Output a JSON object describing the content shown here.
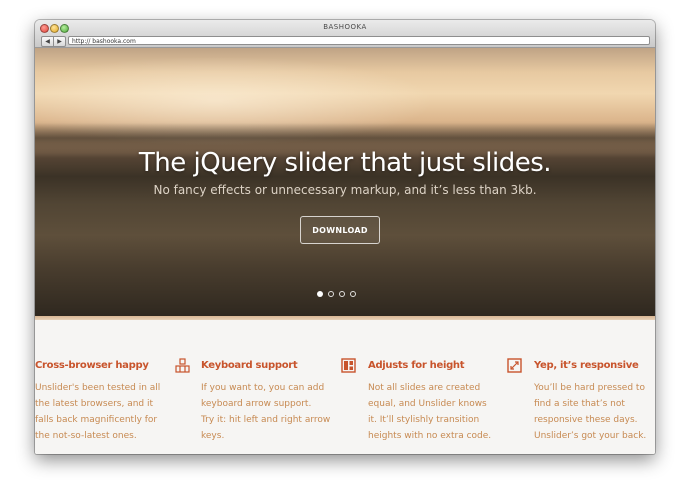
{
  "window": {
    "title": "BASHOOKA",
    "back_glyph": "◀",
    "forward_glyph": "▶",
    "url": "http:// bashooka.com"
  },
  "hero": {
    "title": "The jQuery slider that just slides.",
    "subtitle": "No fancy effects or unnecessary markup, and it’s less than 3kb.",
    "download_label": "DOWNLOAD",
    "slides": {
      "count": 4,
      "active": 1
    }
  },
  "features": [
    {
      "title": "Cross-browser happy",
      "icon": "",
      "lines": [
        "Unslider's been tested in all",
        "the latest browsers, and it",
        "falls back magnificently for",
        "the not-so-latest ones."
      ]
    },
    {
      "title": "Keyboard support",
      "icon": "keyboard-icon",
      "lines": [
        "If you want to, you can add",
        "keyboard arrow support.",
        "Try it: hit left and right arrow",
        "keys."
      ]
    },
    {
      "title": "Adjusts for height",
      "icon": "layout-icon",
      "lines": [
        "Not all slides are created",
        "equal, and Unslider knows",
        "it. It’ll stylishly transition",
        "heights with no extra code."
      ]
    },
    {
      "title": "Yep, it’s responsive",
      "icon": "resize-icon",
      "lines": [
        "You’ll be hard pressed to",
        "find a site that’s not",
        "responsive these days.",
        "Unslider’s got your back."
      ]
    }
  ],
  "colors": {
    "accent": "#c8542c",
    "body_text": "#c78a52",
    "background": "#f6f5f3"
  }
}
